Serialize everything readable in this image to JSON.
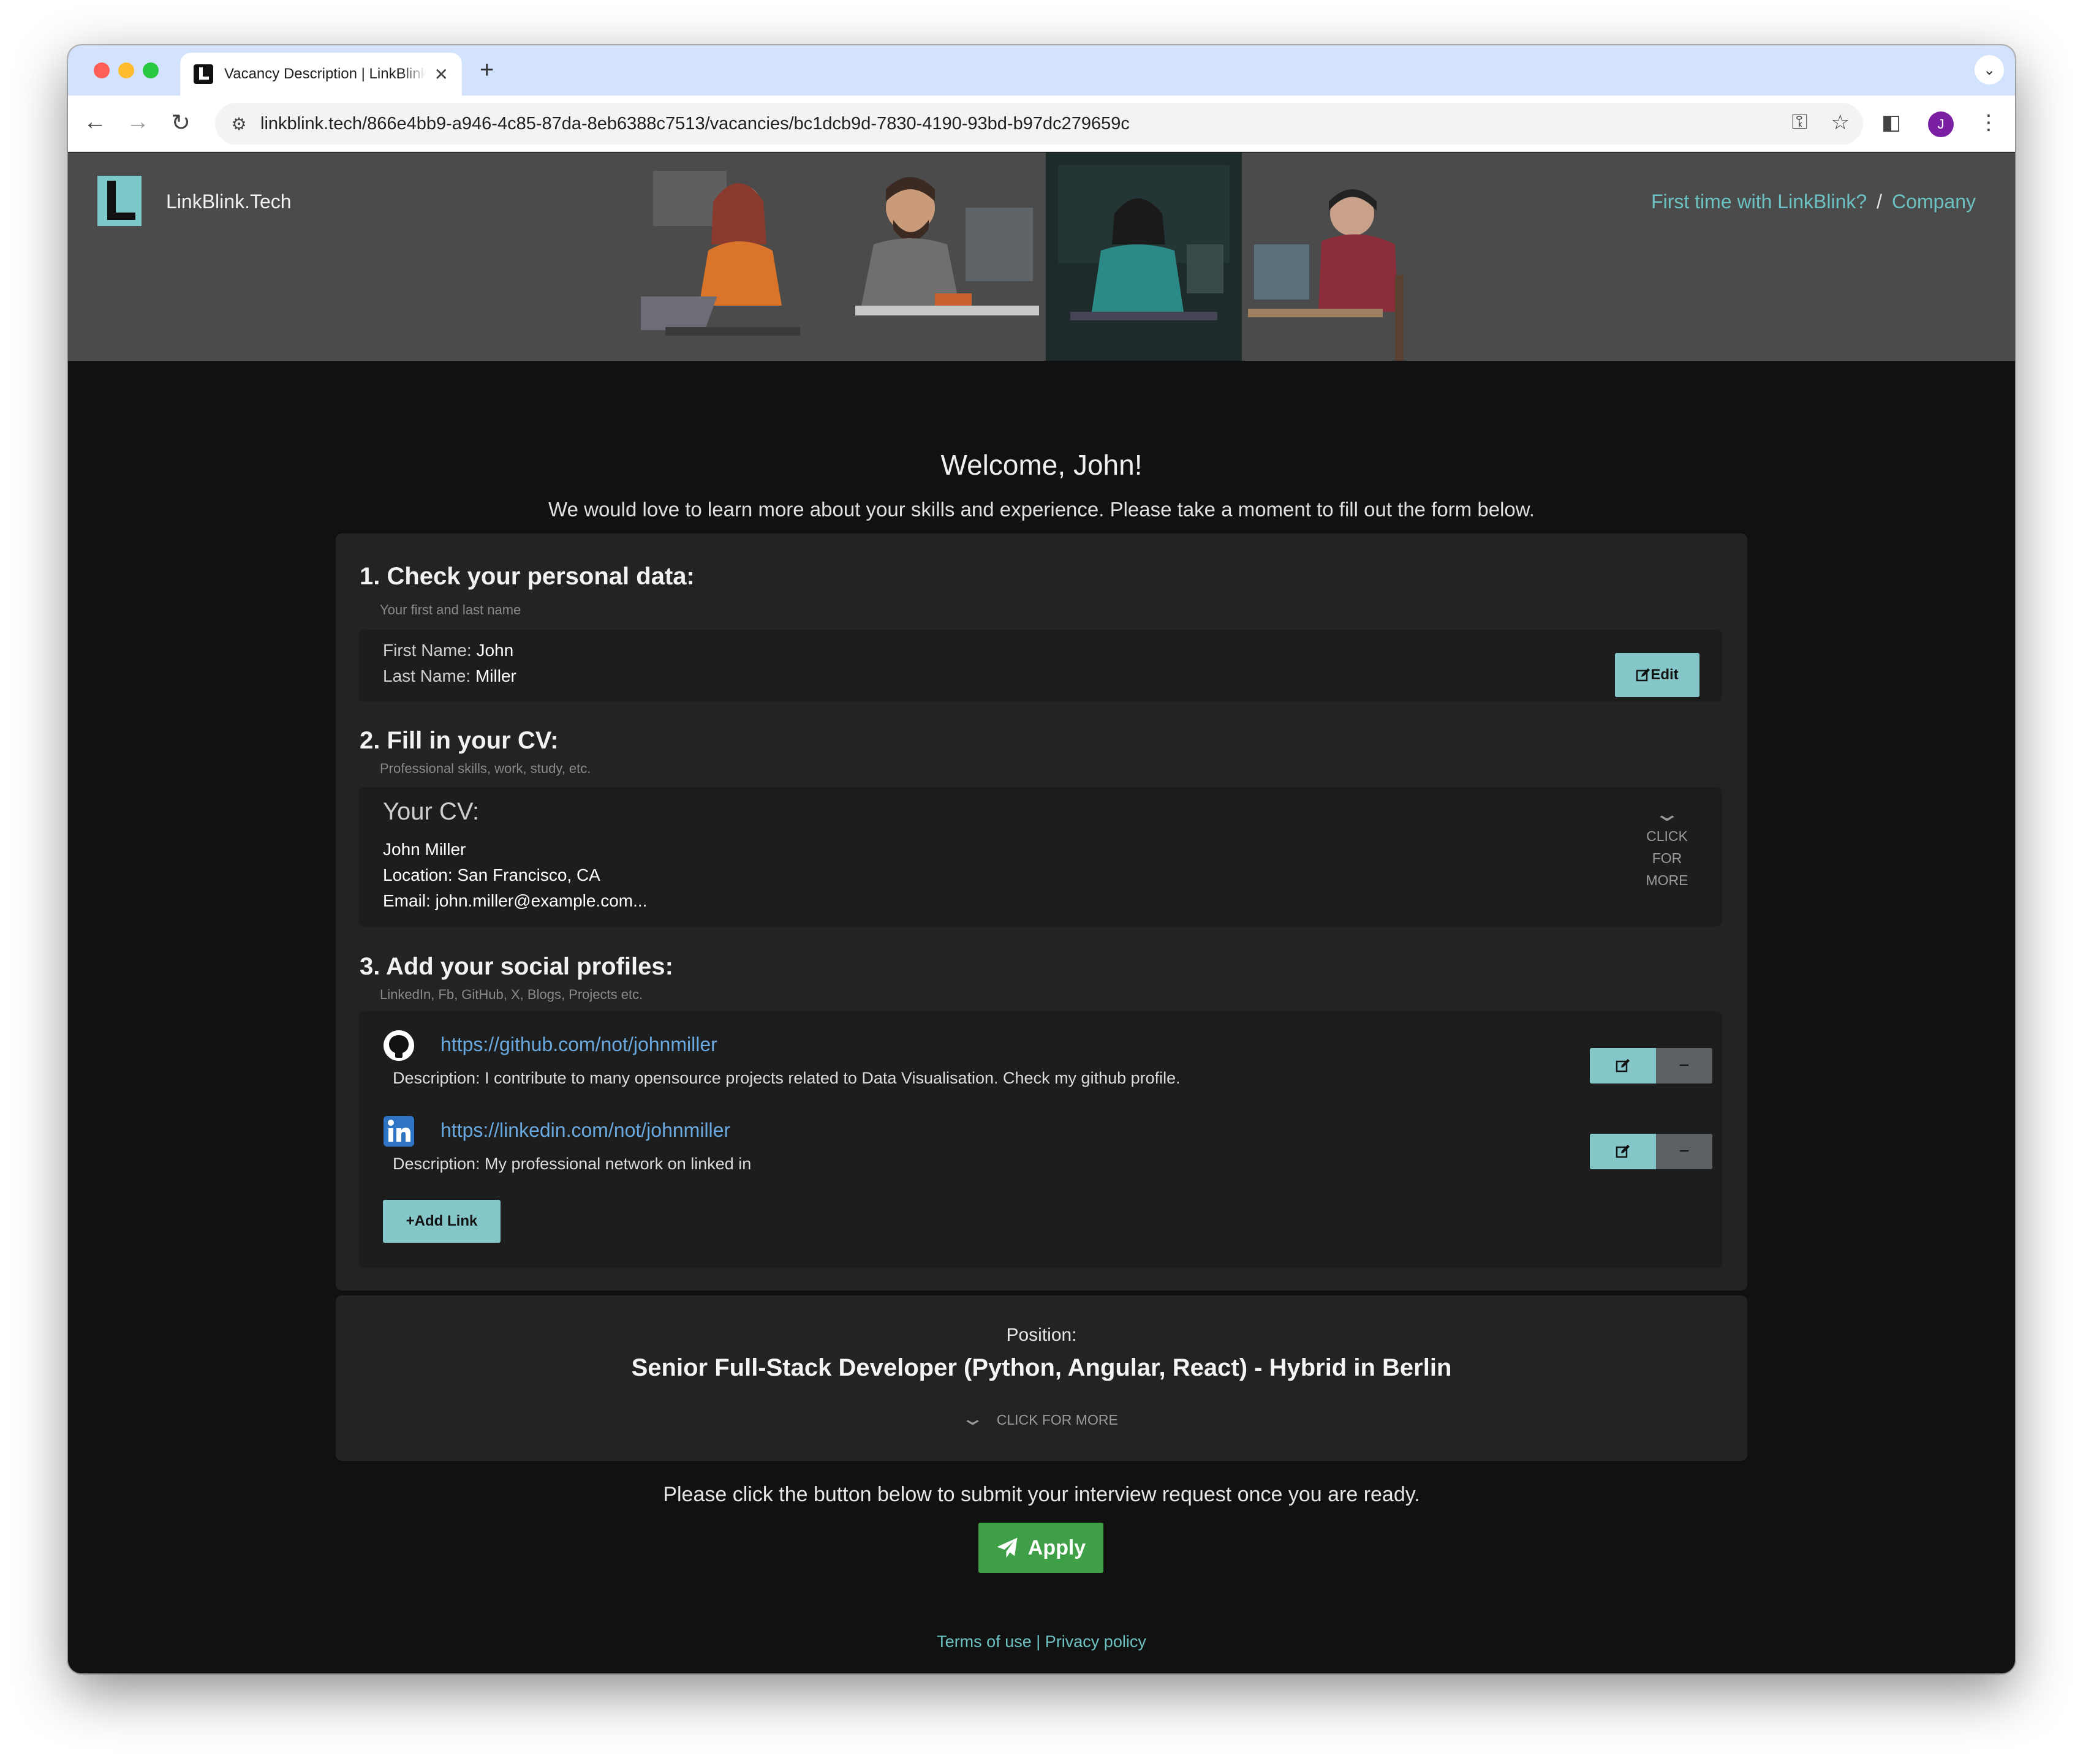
{
  "browser": {
    "tab_title": "Vacancy Description | LinkBlink",
    "tab_close": "✕",
    "new_tab": "+",
    "tab_menu": "⌄",
    "url": "linkblink.tech/866e4bb9-a946-4c85-87da-8eb6388c7513/vacancies/bc1dcb9d-7830-4190-93bd-b97dc279659c",
    "back": "←",
    "forward": "→",
    "reload": "↻",
    "site_info": "⚙",
    "password_key": "⚿",
    "bookmark_star": "☆",
    "side_panel": "◧",
    "profile_initial": "J",
    "menu": "⋮"
  },
  "header": {
    "brand": "LinkBlink.Tech",
    "first_time_link": "First time with LinkBlink?",
    "separator": "/",
    "company_link": "Company"
  },
  "welcome": {
    "title": "Welcome, John!",
    "intro": "We would love to learn more about your skills and experience. Please take a moment to fill out the form below."
  },
  "personal": {
    "title": "1. Check your personal data:",
    "hint": "Your first and last name",
    "first_name_label": "First Name:",
    "first_name": "John",
    "last_name_label": "Last Name:",
    "last_name": "Miller",
    "edit_label": "Edit"
  },
  "cv": {
    "title": "2. Fill in your CV:",
    "hint": "Professional skills, work, study, etc.",
    "heading": "Your CV:",
    "lines": [
      "John Miller",
      "Location: San Francisco, CA",
      "Email: john.miller@example.com..."
    ],
    "more": [
      "CLICK",
      "FOR",
      "MORE"
    ]
  },
  "social": {
    "title": "3. Add your social profiles:",
    "hint": "LinkedIn, Fb, GitHub, X, Blogs, Projects etc.",
    "profiles": [
      {
        "icon": "github-icon",
        "url": "https://github.com/not/johnmiller",
        "description": "Description: I contribute to many opensource projects related to Data Visualisation. Check my github profile."
      },
      {
        "icon": "linkedin-icon",
        "url": "https://linkedin.com/not/johnmiller",
        "description": "Description: My professional network on linked in"
      }
    ],
    "remove_glyph": "−",
    "add_link_label": "Add Link"
  },
  "position": {
    "label": "Position:",
    "title": "Senior Full-Stack Developer (Python, Angular, React) - Hybrid in Berlin",
    "more": "CLICK FOR MORE"
  },
  "submit": {
    "note": "Please click the button below to submit your interview request once you are ready.",
    "apply_label": "Apply"
  },
  "footer": {
    "terms": "Terms of use",
    "separator": "|",
    "privacy": "Privacy policy"
  },
  "colors": {
    "accent_teal": "#85c7c9",
    "link_teal": "#6cc2c2",
    "apply_green": "#3f9f46",
    "link_blue": "#6aa9e0",
    "page_bg": "#111111",
    "card_bg": "#232323"
  }
}
